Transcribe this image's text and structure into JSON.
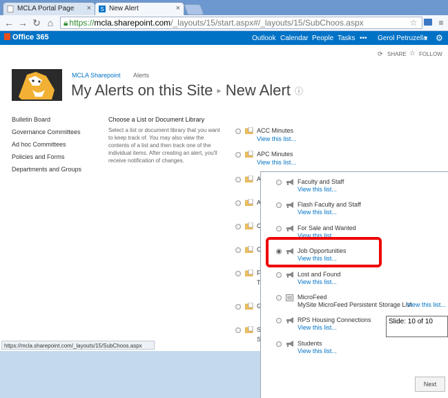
{
  "browser": {
    "tabs": [
      {
        "label": "MCLA Portal Page",
        "active": false
      },
      {
        "label": "New Alert",
        "active": true
      }
    ],
    "url": {
      "scheme": "https://",
      "host": "mcla.sharepoint.com",
      "path": "/_layouts/15/start.aspx#/_layouts/15/SubChoos.aspx"
    },
    "status_url": "https://mcla.sharepoint.com/_layouts/15/SubChoos.aspx"
  },
  "suitebar": {
    "brand": "Office 365",
    "links": [
      "Outlook",
      "Calendar",
      "People",
      "Tasks"
    ],
    "more": "•••",
    "user": "Gerol Petruzella"
  },
  "actions": {
    "share": "SHARE",
    "follow": "FOLLOW"
  },
  "breadcrumb": {
    "site": "MCLA Sharepoint",
    "section": "Alerts"
  },
  "title": {
    "part1": "My Alerts on this Site",
    "sep": "▸",
    "part2": "New Alert",
    "info": "ⓘ"
  },
  "leftnav": [
    "Bulletin Board",
    "Governance Committees",
    "Ad hoc Committees",
    "Policies and Forms",
    "Departments and Groups"
  ],
  "choose": {
    "heading": "Choose a List or Document Library",
    "description": "Select a list or document library that you want to keep track of. You may also view the contents of a list and then track one of the individual items. After creating an alert, you'll receive notification of changes."
  },
  "main_lists": [
    {
      "name": "ACC Minutes",
      "link": "View this list..."
    },
    {
      "name": "APC Minutes",
      "link": "View this list..."
    }
  ],
  "partial_letters": [
    "A",
    "A",
    "C",
    "C",
    "F",
    "T",
    "G",
    "S",
    "S"
  ],
  "panel_lists": [
    {
      "name": "Faculty and Staff",
      "link": "View this list...",
      "selected": false,
      "icon": "announcement-icon"
    },
    {
      "name": "Flash Faculty and Staff",
      "link": "View this list...",
      "selected": false,
      "icon": "announcement-icon"
    },
    {
      "name": "For Sale and Wanted",
      "link": "View this list...",
      "selected": false,
      "icon": "announcement-icon"
    },
    {
      "name": "Job Opportunities",
      "link": "View this list...",
      "selected": true,
      "icon": "announcement-icon"
    },
    {
      "name": "Lost and Found",
      "link": "View this list...",
      "selected": false,
      "icon": "announcement-icon"
    },
    {
      "name": "MicroFeed",
      "sub": "MySite MicroFeed Persistent Storage List",
      "link": "View this list...",
      "selected": false,
      "icon": "list-icon"
    },
    {
      "name": "RPS Housing Connections",
      "link": "View this list...",
      "selected": false,
      "icon": "announcement-icon"
    },
    {
      "name": "Students",
      "link": "View this list...",
      "selected": false,
      "icon": "announcement-icon"
    }
  ],
  "slide": "Slide: 10 of 10",
  "next_label": "Next",
  "colors": {
    "suitebar": "#0072c6",
    "link": "#0072c6",
    "highlight": "#e00000"
  }
}
